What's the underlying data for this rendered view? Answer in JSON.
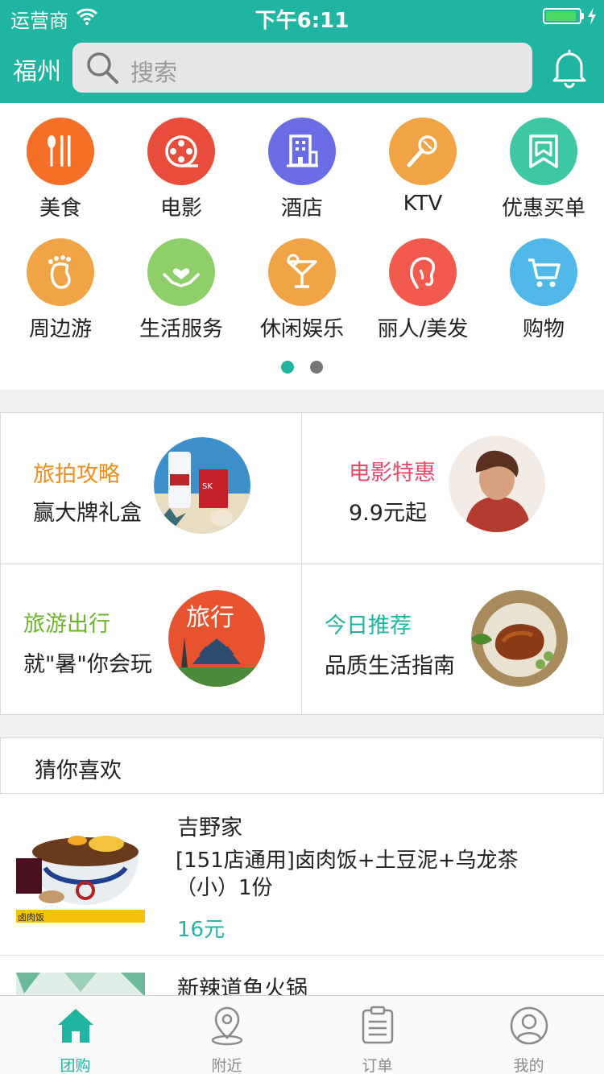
{
  "status_bar": {
    "carrier": "运营商",
    "time": "下午6:11",
    "battery_level": 0.92
  },
  "header": {
    "city": "福州",
    "search_placeholder": "搜索"
  },
  "colors": {
    "brand": "#1fb5a0",
    "price": "#1fb5a0"
  },
  "categories": [
    {
      "label": "美食",
      "icon": "fork-knife-icon",
      "color": "#f56f26"
    },
    {
      "label": "电影",
      "icon": "film-reel-icon",
      "color": "#e74c3c"
    },
    {
      "label": "酒店",
      "icon": "hotel-building-icon",
      "color": "#6a6ce6"
    },
    {
      "label": "KTV",
      "icon": "microphone-icon",
      "color": "#f0a446"
    },
    {
      "label": "优惠买单",
      "icon": "bookmark-icon",
      "color": "#3ec7a5"
    },
    {
      "label": "周边游",
      "icon": "footprint-icon",
      "color": "#f0a446"
    },
    {
      "label": "生活服务",
      "icon": "heart-hands-icon",
      "color": "#8fcf6a"
    },
    {
      "label": "休闲娱乐",
      "icon": "cocktail-icon",
      "color": "#f0a446"
    },
    {
      "label": "丽人/美发",
      "icon": "woman-profile-icon",
      "color": "#f25a4e"
    },
    {
      "label": "购物",
      "icon": "shopping-cart-icon",
      "color": "#4fb8e8"
    }
  ],
  "pager": {
    "pages": 2,
    "current": 1
  },
  "promos": [
    {
      "title": "旅拍攻略",
      "subtitle": "赢大牌礼盒",
      "title_color": "#f08c1c",
      "image": "cosmetics-image"
    },
    {
      "title": "电影特惠",
      "subtitle": "9.9元起",
      "title_color": "#e84a6a",
      "image": "movie-poster-image"
    },
    {
      "title": "旅游出行",
      "subtitle": "就\"暑\"你会玩",
      "title_color": "#6cb52a",
      "image": "travel-image",
      "image_text": "旅行"
    },
    {
      "title": "今日推荐",
      "subtitle": "品质生活指南",
      "title_color": "#1fb5a0",
      "image": "roast-duck-image"
    }
  ],
  "guess": {
    "title": "猜你喜欢",
    "deals": [
      {
        "name": "吉野家",
        "description": "[151店通用]卤肉饭+土豆泥+乌龙茶（小）1份",
        "price": "16元",
        "image": "rice-bowl-image",
        "image_text": "卤肉饭"
      },
      {
        "name": "新辣道鱼火锅",
        "description": "",
        "price": "",
        "image": "hotpot-image"
      }
    ]
  },
  "tabbar": [
    {
      "label": "团购",
      "icon": "home-icon",
      "active": true
    },
    {
      "label": "附近",
      "icon": "location-pin-icon",
      "active": false
    },
    {
      "label": "订单",
      "icon": "clipboard-icon",
      "active": false
    },
    {
      "label": "我的",
      "icon": "user-icon",
      "active": false
    }
  ]
}
